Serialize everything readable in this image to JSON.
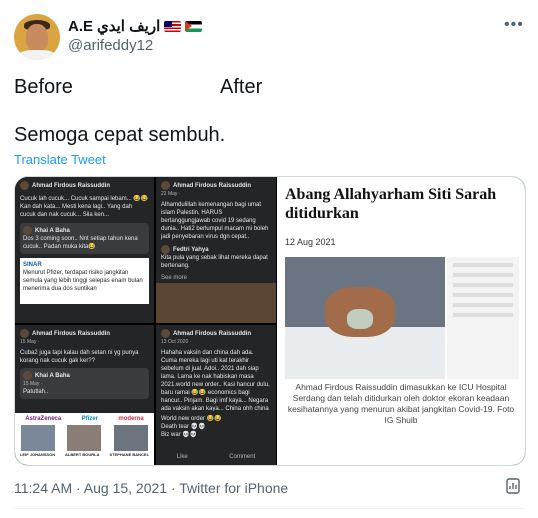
{
  "tweet": {
    "display_name": "A.E",
    "display_name_arabic": "اريف ايدي",
    "handle": "@arifeddy12",
    "line1_left": "Before",
    "line1_right": "After",
    "line2": "Semoga cepat sembuh.",
    "translate_label": "Translate Tweet",
    "timestamp": "11:24 AM · Aug 15, 2021 · Twitter for iPhone"
  },
  "media": {
    "fb_post_1": {
      "author": "Ahmad Firdous Raissuddin",
      "text": "Cucuk lah cucuk... Cucuk sampai lebam... 😂😂 Kan dah kata... Mesti kena lagi.. Yang dah cucuk dan nak cucuk... Sila ken...",
      "reply_author": "Khai A Baha",
      "reply_text": "Dos 3 coming soon.. Nnt setiap tahun kena cucuk.. Padan muka kita😂",
      "share_source": "SINAR",
      "share_text": "Menurut Pfizer, terdapat risiko jangkitan semula yang lebih tinggi selepas enam bulan menerima dua dos suntikan"
    },
    "fb_post_2": {
      "author": "Ahmad Firdous Raissuddin",
      "date": "15 May ·",
      "text": "Cuba2 juga tapi kalau dah setan ni yg punya korang nak cucuk gak ker??",
      "reply_author": "Khai A Baha",
      "reply_date": "15 May ·",
      "reply_text": "Patutlah..",
      "logos": [
        "AstraZeneca",
        "Pfizer",
        "moderna"
      ],
      "people": [
        "LEIF JOHANSSON",
        "ALBERT BOURLA",
        "STEPHANE BANCEL"
      ]
    },
    "fb_post_3": {
      "author": "Ahmad Firdous Raissuddin",
      "date": "22 May ·",
      "text": "Alhamdulillah kemenangan bagi umat islam Palestin. HARUS bertanggungjawab covid 19 sedang dunia.. Hati2 berlumpul macam mi boleh jadi penyebaran virus dgn cepat..",
      "reply_author": "Fedtri Yahya",
      "reply_text": "Kita pula yang sebak lihat mereka dapat bertenang.",
      "see_more": "See more"
    },
    "fb_post_4": {
      "author": "Ahmad Firdous Raissuddin",
      "date": "13 Oct 2020 ·",
      "text": "Hahaha vaksin dan china dah ada. Cuma mereka lagi uti kat terakhir sebelum di jual. Adoi.. 2021 dah siap lama. Lama ke nak habiskan masa 2021.world new order.. Kasi hancur dulu, baru ramai 😂😂 economics bagi hancur.. Pinjam. Bagi imf kaya... Negara ada vaksin akan kaya... China ohh china habis 1 dunia ko game.",
      "footer1": "World new order 😂😂",
      "footer2": "Death tear 💀💀",
      "footer3": "Biz war 💀💀",
      "actions": [
        "Like",
        "Comment"
      ]
    },
    "news": {
      "headline": "Abang Allahyarham Siti Sarah ditidurkan",
      "date": "12 Aug 2021",
      "caption": "Ahmad Firdous Raissuddin dimasukkan ke ICU Hospital Serdang dan telah ditidurkan oleh doktor ekoran keadaan kesihatannya yang menurun akibat jangkitan Covid-19. Foto IG Shuib"
    }
  },
  "icons": {
    "more": "more-horizontal-icon",
    "analytics": "analytics-icon",
    "flags": [
      "malaysia-flag-icon",
      "palestine-flag-icon"
    ]
  },
  "colors": {
    "link": "#1d9bf0",
    "secondary_text": "#536471",
    "border": "#cfd9de"
  }
}
